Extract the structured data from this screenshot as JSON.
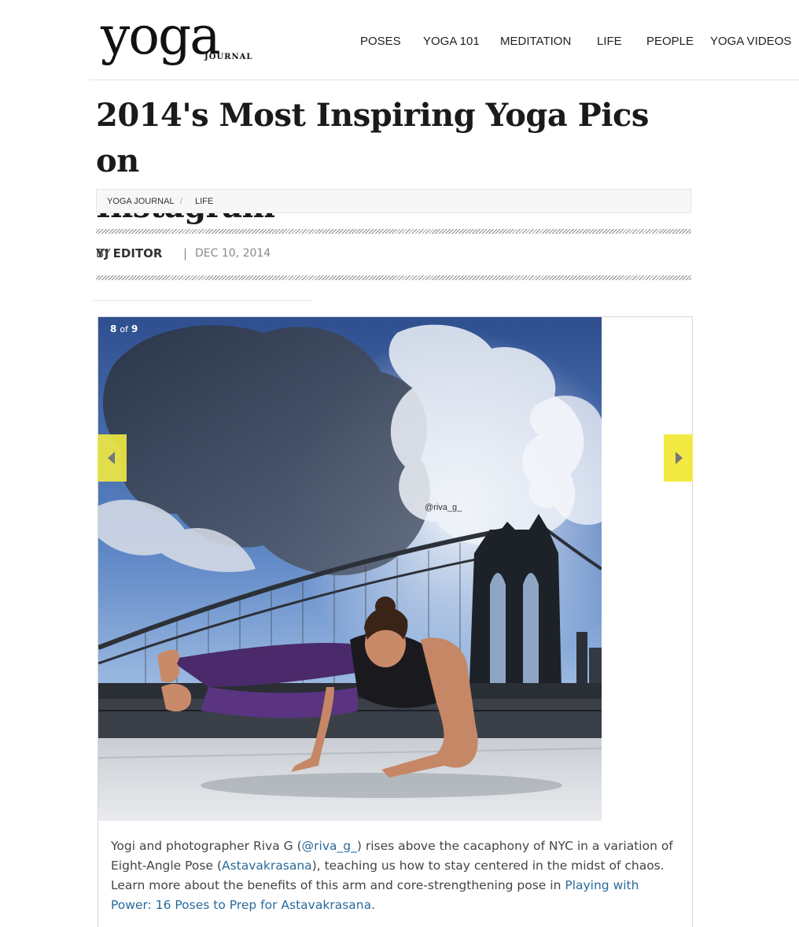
{
  "logo": {
    "wordmark": "yoga",
    "subtext": "JOURNAL"
  },
  "nav": {
    "items": [
      {
        "label": "POSES"
      },
      {
        "label": "YOGA 101"
      },
      {
        "label": "MEDITATION"
      },
      {
        "label": "LIFE"
      },
      {
        "label": "PEOPLE"
      },
      {
        "label": "YOGA VIDEOS"
      }
    ]
  },
  "article": {
    "title_line1": "2014's Most Inspiring Yoga Pics on",
    "title_line2": "Instagram",
    "breadcrumb": [
      {
        "label": "YOGA JOURNAL"
      },
      {
        "label": "LIFE"
      }
    ],
    "breadcrumb_separator": "/",
    "byline": {
      "prefix": "BY",
      "author": "YJ EDITOR",
      "divider": "|",
      "date": "DEC 10, 2014"
    }
  },
  "slideshow": {
    "current": "8",
    "of": "of",
    "total": "9",
    "watermark": "@riva_g_",
    "caption": {
      "text_1": "Yogi and photographer Riva G (",
      "link_handle": "@riva_g_",
      "text_2": ") rises above the cacaphony of NYC in a variation of Eight-Angle Pose (",
      "link_pose": "Astavakrasana",
      "text_3": "), teaching us how to stay centered in the midst of chaos. Learn more about the benefits of this arm and core-strengthening pose in ",
      "link_article": "Playing with Power: 16 Poses to Prep for Astavakrasana",
      "text_4": "."
    }
  },
  "colors": {
    "arrow_bg": "#f2ea42",
    "link": "#2a6a9a",
    "sky": "#4f78b8"
  }
}
